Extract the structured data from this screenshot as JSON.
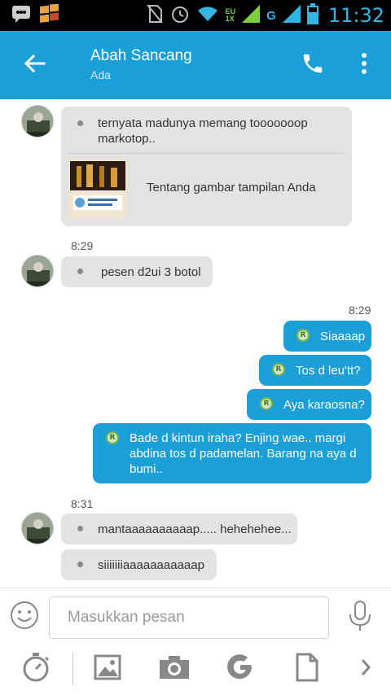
{
  "status_bar": {
    "time": "11:32",
    "network_top": "EU",
    "network_bottom": "1X",
    "network_type": "G",
    "icons": [
      "bbm-icon",
      "windows-app-icon",
      "no-sim-icon",
      "alarm-icon",
      "wifi-icon",
      "signal-icon",
      "battery-icon"
    ]
  },
  "header": {
    "contact_name": "Abah Sancang",
    "status": "Ada",
    "back_icon": "arrow-left-icon",
    "call_icon": "phone-icon",
    "menu_icon": "more-vertical-icon",
    "color": "#1b9fd9"
  },
  "messages": [
    {
      "direction": "in",
      "text": "ternyata madunya memang tooooooop markotop..",
      "link_preview": {
        "title": "Tentang gambar tampilan Anda"
      }
    },
    {
      "direction": "in",
      "time": "8:29",
      "text": "pesen d2ui 3 botol"
    },
    {
      "direction": "out",
      "time": "8:29",
      "text": "Siaaaap",
      "badge": "R"
    },
    {
      "direction": "out",
      "text": "Tos d leu'tt?",
      "badge": "R"
    },
    {
      "direction": "out",
      "text": "Aya karaosna?",
      "badge": "R"
    },
    {
      "direction": "out",
      "text": "Bade d kintun iraha? Enjing wae.. margi abdina tos d padamelan. Barang na aya d bumi..",
      "badge": "R"
    },
    {
      "direction": "in",
      "time": "8:31",
      "text": "mantaaaaaaaaaap..... hehehehee..."
    },
    {
      "direction": "in",
      "text": "siiiiiiiaaaaaaaaaaap"
    }
  ],
  "composer": {
    "placeholder": "Masukkan pesan",
    "emoji_icon": "smiley-icon",
    "mic_icon": "microphone-icon"
  },
  "toolbar": {
    "icons": [
      "timer-icon",
      "image-icon",
      "camera-icon",
      "google-icon",
      "document-icon",
      "chevron-right-icon"
    ]
  },
  "colors": {
    "outgoing_bubble": "#1b9fd9",
    "incoming_bubble": "#e3e3e3",
    "status_clock": "#33b5e5"
  }
}
